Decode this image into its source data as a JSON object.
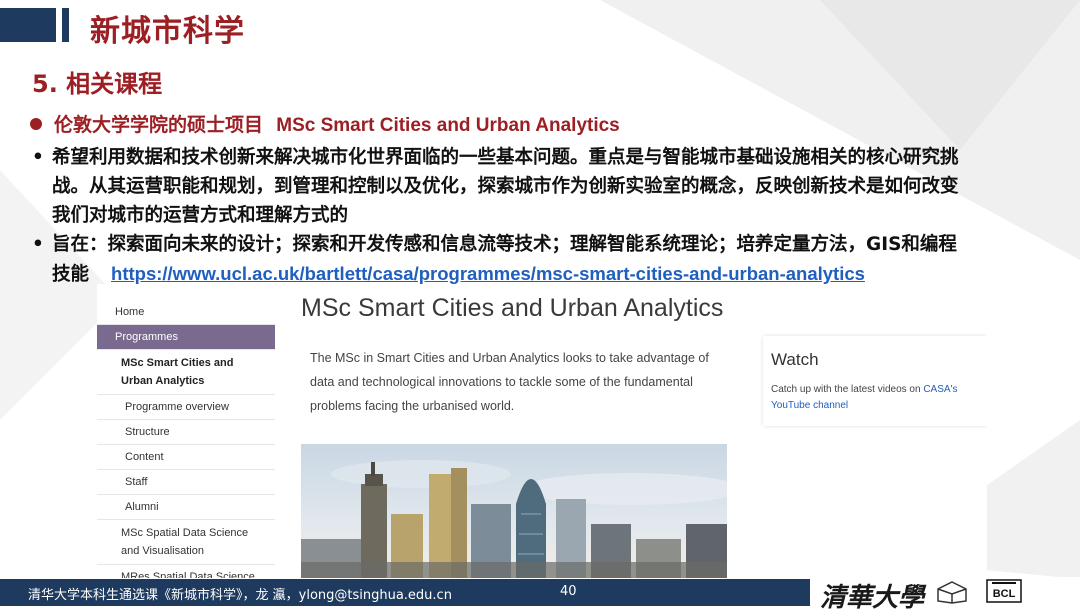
{
  "header": {
    "title": "新城市科学"
  },
  "section": {
    "title": "5. 相关课程"
  },
  "bullet": {
    "prefix": "伦敦大学学院的硕士项目",
    "program": "MSc Smart Cities and Urban Analytics"
  },
  "paragraphs": {
    "p1_line1": "希望利用数据和技术创新来解决城市化世界面临的一些基本问题。重点是与智能城市基础设施相关的核心研究挑",
    "p1_line2": "战。从其运营职能和规划，到管理和控制以及优化，探索城市作为创新实验室的概念，反映创新技术是如何改变",
    "p1_line3": "我们对城市的运营方式和理解方式的",
    "p2_line1": "旨在：探索面向未来的设计；探索和开发传感和信息流等技术；理解智能系统理论；培养定量方法，GIS和编程",
    "p2_line2": "技能",
    "link": "https://www.ucl.ac.uk/bartlett/casa/programmes/msc-smart-cities-and-urban-analytics"
  },
  "screenshot": {
    "nav": {
      "home": "Home",
      "programmes": "Programmes",
      "current": "MSc Smart Cities and Urban Analytics",
      "overview": "Programme overview",
      "structure": "Structure",
      "content": "Content",
      "staff": "Staff",
      "alumni": "Alumni",
      "spatial": "MSc Spatial Data Science and Visualisation",
      "mres": "MRes Spatial Data Science"
    },
    "title": "MSc Smart Cities and Urban Analytics",
    "intro": "The MSc in Smart Cities and Urban Analytics looks to take advantage of data and technological innovations to tackle some of the fundamental problems facing the urbanised world.",
    "watch": {
      "heading": "Watch",
      "text": "Catch up with the latest videos on ",
      "link": "CASA's YouTube channel"
    }
  },
  "footer": {
    "text": "清华大学本科生通选课《新城市科学》，龙 瀛，ylong@tsinghua.edu.cn",
    "page": "40",
    "university": "清華大學",
    "lab": "BCL"
  },
  "colors": {
    "brand_red": "#9c1f24",
    "navy": "#1e3a5f",
    "link": "#1f5fbf",
    "nav_active": "#7a6a8f"
  }
}
